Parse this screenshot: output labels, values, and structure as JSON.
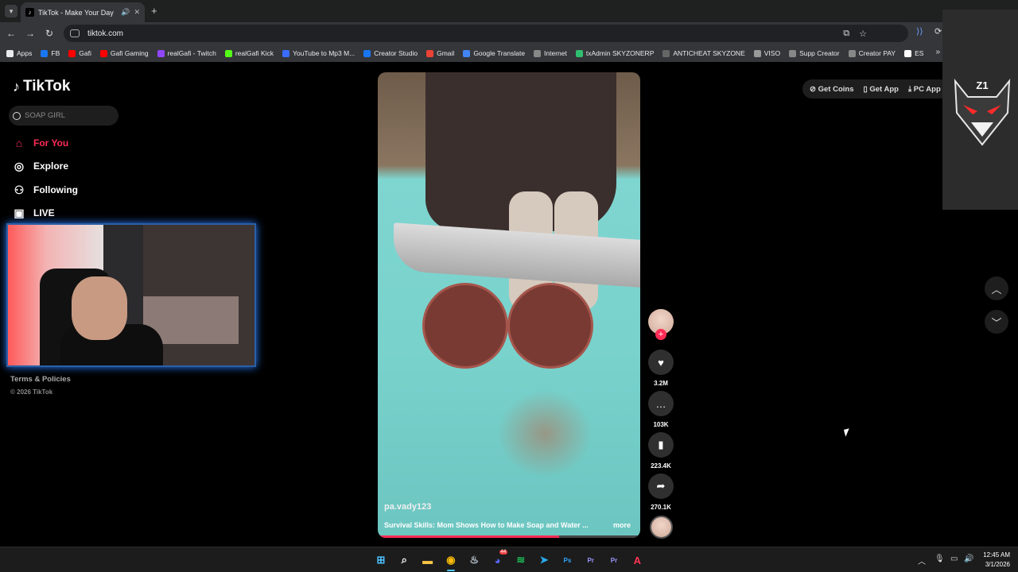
{
  "browser": {
    "tab_title": "TikTok - Make Your Day",
    "url": "tiktok.com",
    "bookmarks": [
      {
        "label": "Apps",
        "color": "#e8eaed"
      },
      {
        "label": "FB",
        "color": "#1877f2"
      },
      {
        "label": "Gafi",
        "color": "#ff0000"
      },
      {
        "label": "Gafi Gaming",
        "color": "#ff0000"
      },
      {
        "label": "realGafi - Twitch",
        "color": "#9146ff"
      },
      {
        "label": "realGafi Kick",
        "color": "#53fc18"
      },
      {
        "label": "YouTube to Mp3 M...",
        "color": "#3b6cff"
      },
      {
        "label": "Creator Studio",
        "color": "#1877f2"
      },
      {
        "label": "Gmail",
        "color": "#ea4335"
      },
      {
        "label": "Google Translate",
        "color": "#4285f4"
      },
      {
        "label": "Internet",
        "color": "#888888"
      },
      {
        "label": "txAdmin SKYZONERP",
        "color": "#2fbf71"
      },
      {
        "label": "ANTICHEAT SKYZONE",
        "color": "#666666"
      },
      {
        "label": "VISO",
        "color": "#999999"
      },
      {
        "label": "Supp Creator",
        "color": "#888888"
      },
      {
        "label": "Creator PAY",
        "color": "#888888"
      },
      {
        "label": "ES",
        "color": "#ffffff"
      }
    ]
  },
  "tiktok": {
    "logo": "TikTok",
    "search_placeholder": "SOAP GIRL",
    "nav": [
      {
        "label": "For You",
        "icon": "home-icon"
      },
      {
        "label": "Explore",
        "icon": "compass-icon"
      },
      {
        "label": "Following",
        "icon": "following-icon"
      },
      {
        "label": "LIVE",
        "icon": "live-icon"
      }
    ],
    "footer_link": "Terms & Policies",
    "copyright": "© 2026 TikTok",
    "top_actions": [
      "Get Coins",
      "Get App",
      "PC App"
    ],
    "video": {
      "username": "pa.vady123",
      "description": "Survival Skills: Mom Shows How to Make Soap and Water ...",
      "more": "more",
      "progress": 0.69
    },
    "actions": {
      "likes": "3.2M",
      "comments": "103K",
      "saves": "223.4K",
      "shares": "270.1K"
    }
  },
  "overlay": {
    "badge": "Z1"
  },
  "taskbar": {
    "time": "12:45 AM",
    "date": "3/1/2026",
    "discord_badge": "44",
    "apps": [
      {
        "name": "start",
        "label": "⊞",
        "color": "#4cc2ff"
      },
      {
        "name": "search",
        "label": "⌕",
        "color": "#ffffff"
      },
      {
        "name": "explorer",
        "label": "▬",
        "color": "#f6c445"
      },
      {
        "name": "chrome",
        "label": "◉",
        "color": "#fbbc05"
      },
      {
        "name": "steam",
        "label": "♨",
        "color": "#c7d5e0"
      },
      {
        "name": "discord",
        "label": "◕",
        "color": "#5865f2"
      },
      {
        "name": "spotify",
        "label": "≋",
        "color": "#1db954"
      },
      {
        "name": "telegram",
        "label": "➤",
        "color": "#2aabee"
      },
      {
        "name": "photoshop",
        "label": "Ps",
        "color": "#31a8ff"
      },
      {
        "name": "premiere",
        "label": "Pr",
        "color": "#9999ff"
      },
      {
        "name": "premiere2",
        "label": "Pr",
        "color": "#9999ff"
      },
      {
        "name": "app",
        "label": "A",
        "color": "#ff3355"
      }
    ]
  }
}
